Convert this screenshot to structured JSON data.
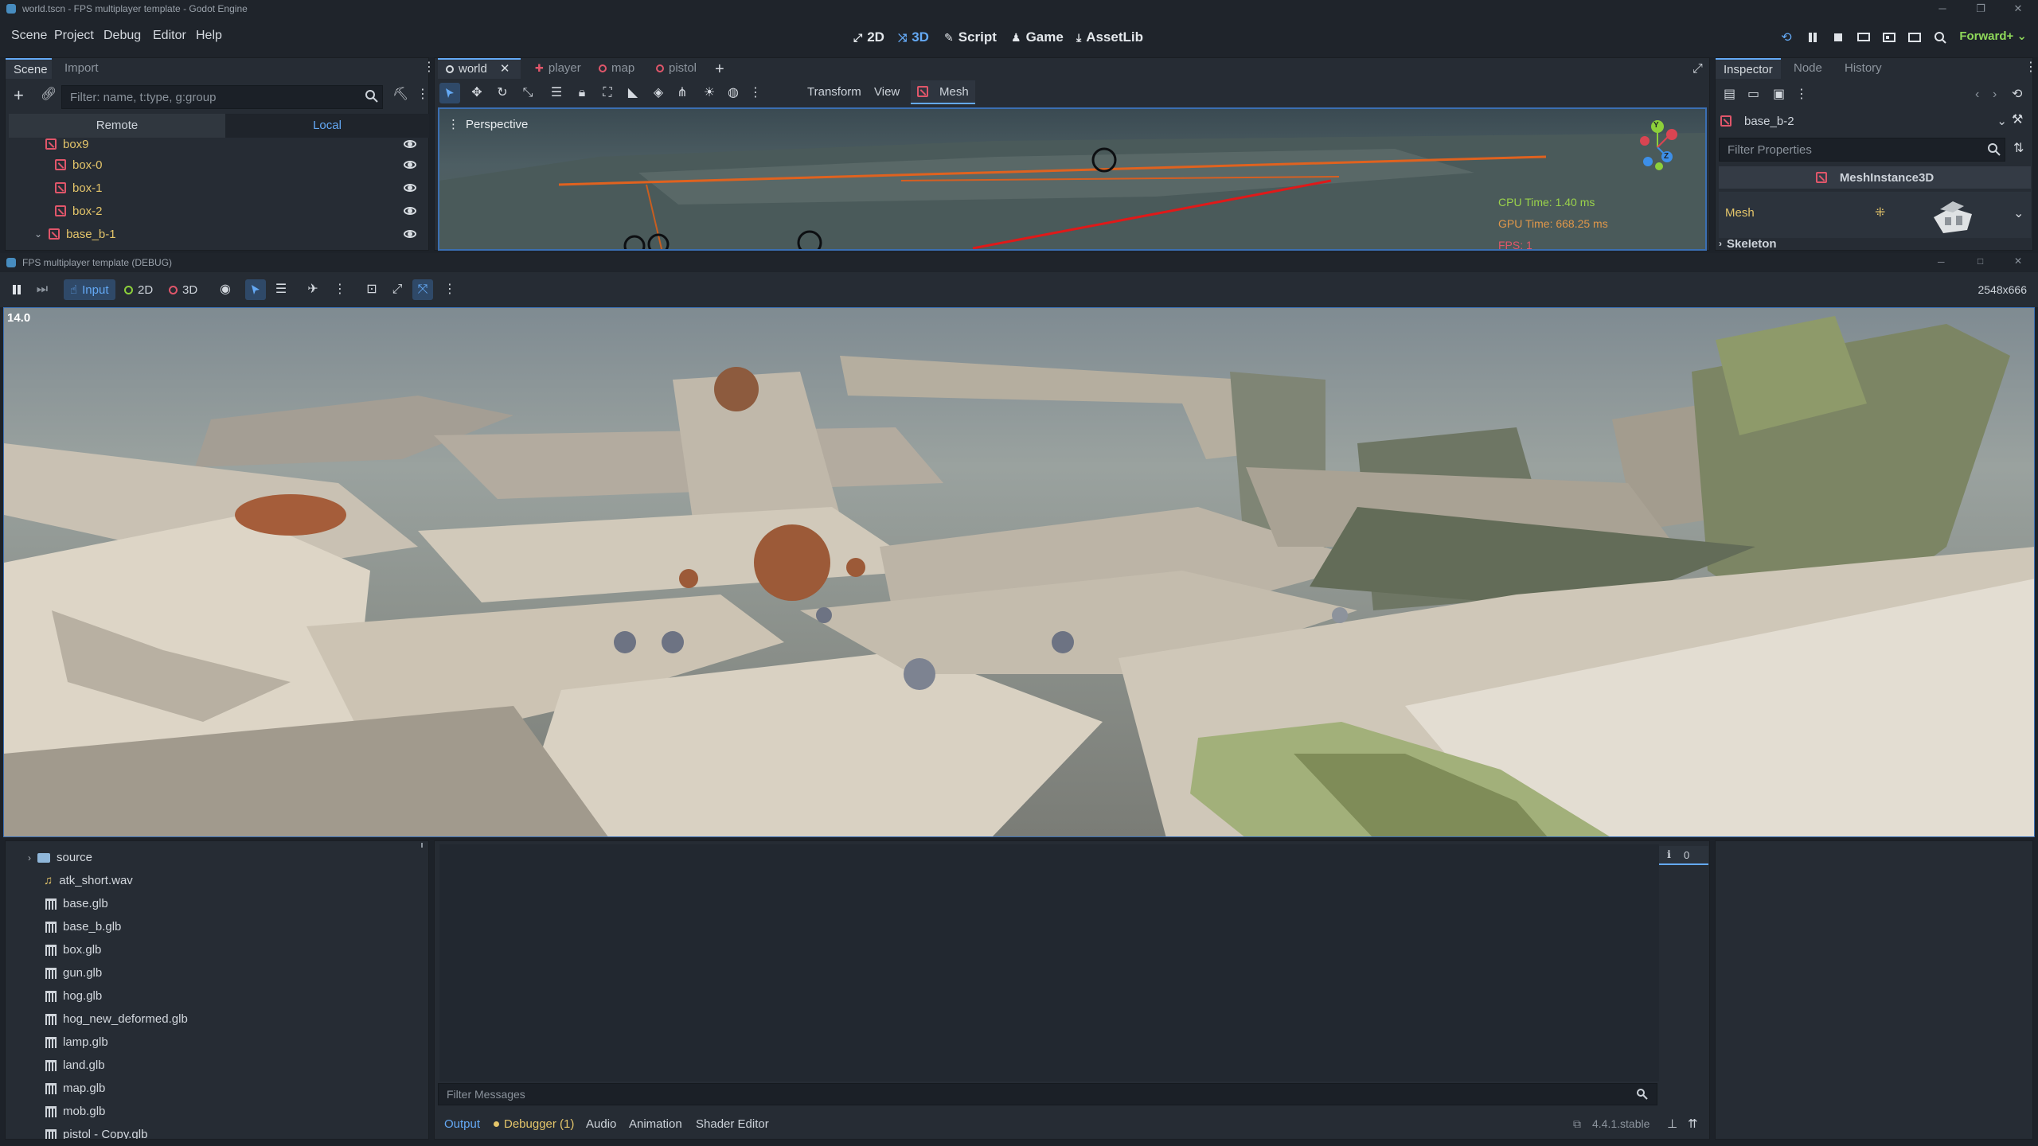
{
  "window": {
    "title": "world.tscn - FPS multiplayer template - Godot Engine"
  },
  "menubar": {
    "items": [
      "Scene",
      "Project",
      "Debug",
      "Editor",
      "Help"
    ],
    "workspaces": [
      {
        "label": "2D",
        "icon": "2d-icon"
      },
      {
        "label": "3D",
        "icon": "3d-icon"
      },
      {
        "label": "Script",
        "icon": "script-icon"
      },
      {
        "label": "Game",
        "icon": "game-icon"
      },
      {
        "label": "AssetLib",
        "icon": "assetlib-icon"
      }
    ],
    "renderer": "Forward+"
  },
  "scene_dock": {
    "tabs": [
      "Scene",
      "Import"
    ],
    "filter_placeholder": "Filter: name, t:type, g:group",
    "remote": "Remote",
    "local": "Local",
    "tree": [
      {
        "name": "box9",
        "indent": 1
      },
      {
        "name": "box-0",
        "indent": 2
      },
      {
        "name": "box-1",
        "indent": 2
      },
      {
        "name": "box-2",
        "indent": 2
      },
      {
        "name": "base_b-1",
        "indent": 1
      }
    ]
  },
  "editor_tabs": [
    "world",
    "player",
    "map",
    "pistol"
  ],
  "viewport_toolbar": {
    "transform": "Transform",
    "view": "View",
    "mesh": "Mesh"
  },
  "viewport": {
    "perspective": "Perspective",
    "cpu_time": "CPU Time: 1.40 ms",
    "gpu_time": "GPU Time: 668.25 ms",
    "fps": "FPS: 1",
    "gizmo": {
      "x": "X",
      "y": "Y",
      "z": "Z"
    }
  },
  "inspector": {
    "tabs": [
      "Inspector",
      "Node",
      "History"
    ],
    "node_name": "base_b-2",
    "filter_placeholder": "Filter Properties",
    "class_name": "MeshInstance3D",
    "mesh_label": "Mesh",
    "skeleton_label": "Skeleton"
  },
  "game_window": {
    "title": "FPS multiplayer template (DEBUG)",
    "toolbar": {
      "input": "Input",
      "two_d": "2D",
      "three_d": "3D"
    },
    "resolution": "2548x666",
    "fps_counter": "14.0"
  },
  "filesystem": {
    "items": [
      {
        "name": "source",
        "type": "folder"
      },
      {
        "name": "atk_short.wav",
        "type": "audio"
      },
      {
        "name": "base.glb",
        "type": "glb"
      },
      {
        "name": "base_b.glb",
        "type": "glb"
      },
      {
        "name": "box.glb",
        "type": "glb"
      },
      {
        "name": "gun.glb",
        "type": "glb"
      },
      {
        "name": "hog.glb",
        "type": "glb"
      },
      {
        "name": "hog_new_deformed.glb",
        "type": "glb"
      },
      {
        "name": "lamp.glb",
        "type": "glb"
      },
      {
        "name": "land.glb",
        "type": "glb"
      },
      {
        "name": "map.glb",
        "type": "glb"
      },
      {
        "name": "mob.glb",
        "type": "glb"
      },
      {
        "name": "pistol - Copy.glb",
        "type": "glb"
      }
    ]
  },
  "bottom_panel": {
    "filter_placeholder": "Filter Messages",
    "tabs": [
      "Output",
      "Debugger (1)",
      "Audio",
      "Animation",
      "Shader Editor"
    ],
    "version": "4.4.1.stable",
    "message_count": "0"
  },
  "colors": {
    "accent": "#64a9f5",
    "node_red": "#e0566a",
    "node_yellow": "#e4c56a",
    "renderer_green": "#8fd95a"
  }
}
